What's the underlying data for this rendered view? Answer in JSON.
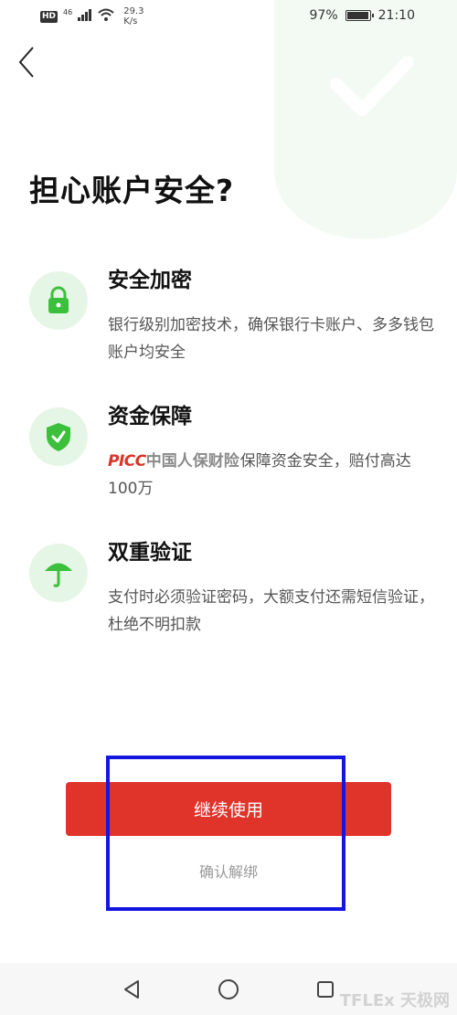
{
  "status_bar": {
    "hd": "HD",
    "network": "46",
    "speed_value": "29.3",
    "speed_unit": "K/s",
    "battery": "97%",
    "battery_level": 0.97,
    "time": "21:10"
  },
  "page": {
    "title": "担心账户安全?"
  },
  "features": [
    {
      "icon": "lock-icon",
      "title": "安全加密",
      "desc": "银行级别加密技术，确保银行卡账户、多多钱包账户均安全"
    },
    {
      "icon": "shield-check-icon",
      "title": "资金保障",
      "brand_logo_en": "PICC",
      "brand_logo_cn": "中国人保财险",
      "desc": "保障资金安全，赔付高达100万"
    },
    {
      "icon": "umbrella-icon",
      "title": "双重验证",
      "desc": "支付时必须验证密码，大额支付还需短信验证，杜绝不明扣款"
    }
  ],
  "actions": {
    "continue_label": "继续使用",
    "unbind_label": "确认解绑"
  },
  "watermark": "TFLEx 天极网"
}
